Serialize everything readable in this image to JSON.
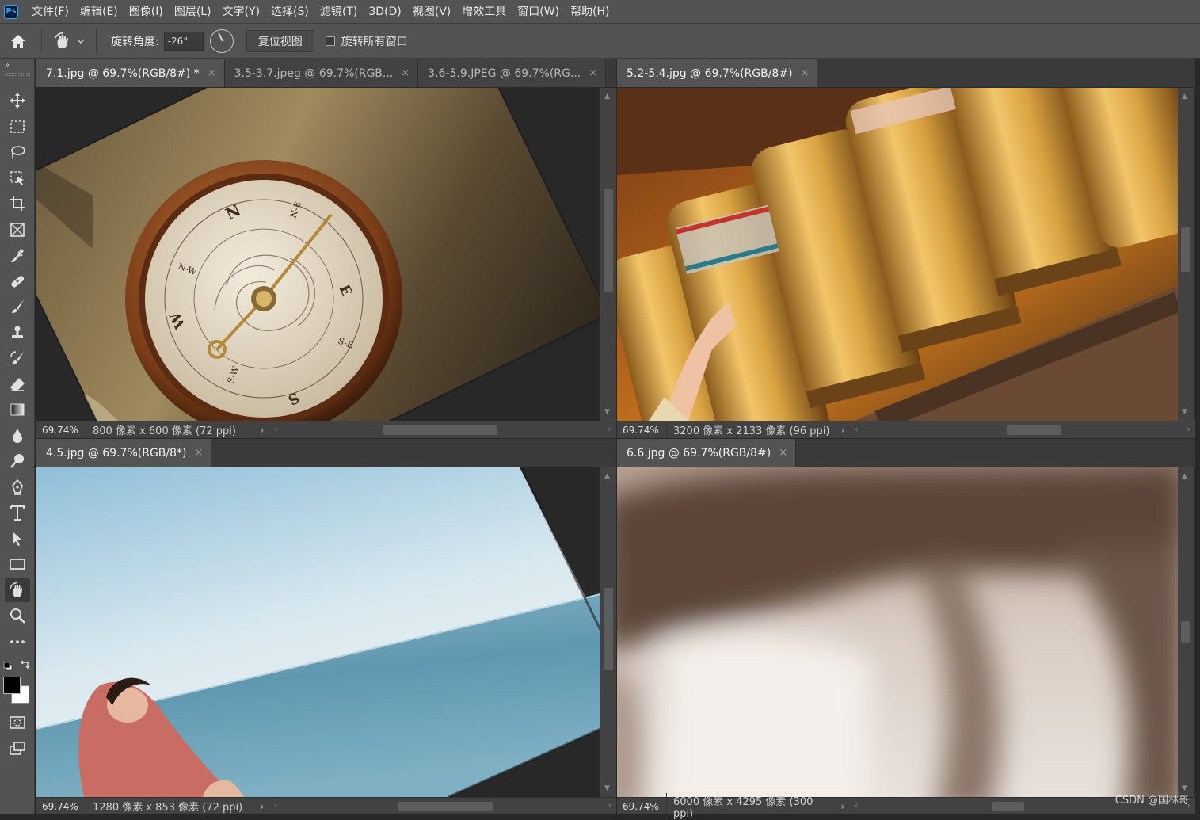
{
  "app": {
    "logo": "Ps"
  },
  "menu": [
    "文件(F)",
    "编辑(E)",
    "图像(I)",
    "图层(L)",
    "文字(Y)",
    "选择(S)",
    "滤镜(T)",
    "3D(D)",
    "视图(V)",
    "增效工具",
    "窗口(W)",
    "帮助(H)"
  ],
  "options": {
    "rotation_label": "旋转角度:",
    "rotation_value": "-26°",
    "reset_view": "复位视图",
    "rotate_all_label": "旋转所有窗口",
    "rotate_all_checked": false
  },
  "toolbar": {
    "collapse": "»",
    "tools": [
      "move-icon",
      "marquee-icon",
      "lasso-icon",
      "object-select-icon",
      "crop-icon",
      "frame-icon",
      "eyedropper-icon",
      "healing-icon",
      "brush-icon",
      "stamp-icon",
      "history-brush-icon",
      "eraser-icon",
      "gradient-icon",
      "blur-icon",
      "dodge-icon",
      "pen-icon",
      "type-icon",
      "path-select-icon",
      "rectangle-icon",
      "rotate-view-icon",
      "zoom-icon",
      "more-icon"
    ],
    "active_tool": "rotate-view-icon",
    "foreground": "#000000",
    "background": "#ffffff"
  },
  "docs": {
    "tl": {
      "tabs": [
        {
          "label": "7.1.jpg @ 69.7%(RGB/8#) *",
          "active": true
        },
        {
          "label": "3.5-3.7.jpeg @ 69.7%(RGB...",
          "active": false
        },
        {
          "label": "3.6-5.9.JPEG @ 69.7%(RG...",
          "active": false
        }
      ],
      "zoom": "69.74%",
      "info": "800 像素 x 600 像素 (72 ppi)",
      "compass": {
        "N": "N",
        "E": "E",
        "S": "S",
        "W": "W",
        "NE": "N-E",
        "SE": "S-E",
        "SW": "S-W",
        "NW": "N-W"
      }
    },
    "tr": {
      "tabs": [
        {
          "label": "5.2-5.4.jpg @ 69.7%(RGB/8#)",
          "active": true
        }
      ],
      "zoom": "69.74%",
      "info": "3200 像素 x 2133 像素 (96 ppi)"
    },
    "bl": {
      "tabs": [
        {
          "label": "4.5.jpg @ 69.7%(RGB/8*)",
          "active": true
        }
      ],
      "zoom": "69.74%",
      "info": "1280 像素 x 853 像素 (72 ppi)"
    },
    "br": {
      "tabs": [
        {
          "label": "6.6.jpg @ 69.7%(RGB/8#)",
          "active": true
        }
      ],
      "zoom": "69.74%",
      "info": "6000 像素 x 4295 像素 (300 ppi)"
    }
  },
  "close_glyph": "×",
  "status_arrow": "›",
  "watermark": "CSDN @国林哥"
}
